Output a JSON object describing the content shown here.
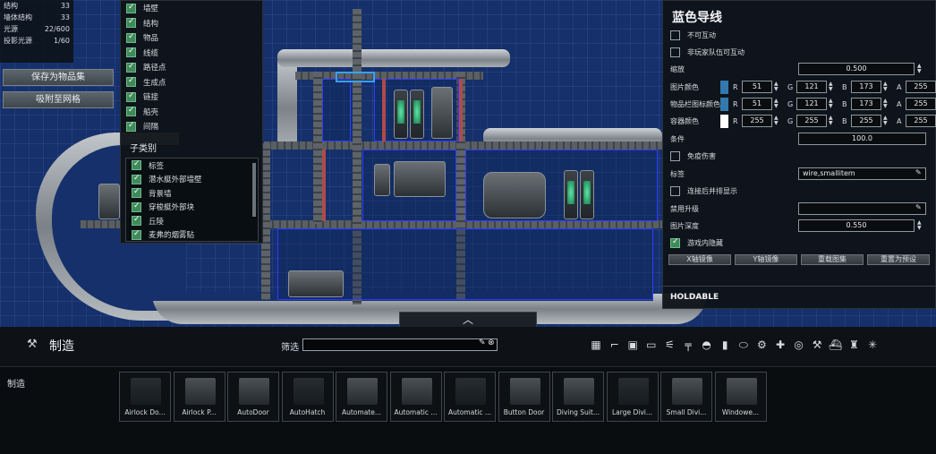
{
  "stats": [
    {
      "label": "结构",
      "value": "33"
    },
    {
      "label": "墙体结构",
      "value": "33"
    },
    {
      "label": "光源",
      "value": "22/600"
    },
    {
      "label": "投影光源",
      "value": "1/60"
    }
  ],
  "left_buttons": {
    "save": "保存为物品集",
    "snap": "吸附至网格"
  },
  "layers": {
    "items": [
      "墙壁",
      "结构",
      "物品",
      "线缆",
      "路径点",
      "生成点",
      "链接",
      "船壳",
      "间隔"
    ],
    "subcategory_title": "子类别",
    "subcategories": [
      "标签",
      "潜水艇外部墙壁",
      "背景墙",
      "穿梭艇外部块",
      "丘陵",
      "麦弗的烟雾贴"
    ]
  },
  "properties": {
    "title": "蓝色导线",
    "non_interactable_label": "不可互动",
    "player_team_interactable_label": "非玩家队伍可互动",
    "scale_label": "缩放",
    "scale_value": "0.500",
    "sprite_color_label": "图片颜色",
    "inventory_color_label": "物品栏图标颜色",
    "container_color_label": "容器颜色",
    "sprite_color": {
      "r": "51",
      "g": "121",
      "b": "173",
      "a": "255",
      "hex": "#3379ad"
    },
    "inventory_color": {
      "r": "51",
      "g": "121",
      "b": "173",
      "a": "255",
      "hex": "#3379ad"
    },
    "container_color": {
      "r": "255",
      "g": "255",
      "b": "255",
      "a": "255",
      "hex": "#ffffff"
    },
    "condition_label": "条件",
    "condition_value": "100.0",
    "invulnerable_label": "免疫伤害",
    "tags_label": "标签",
    "tags_value": "wire,smallitem",
    "hidden_after_connect_label": "连接后并排显示",
    "disallowed_upgrades_label": "禁用升级",
    "disallowed_upgrades_value": "",
    "sprite_depth_label": "图片深度",
    "sprite_depth_value": "0.550",
    "hidden_in_game_label": "游戏内隐藏",
    "buttons": [
      "X轴镜像",
      "Y轴镜像",
      "重载图集",
      "重置为预设"
    ],
    "section_holdable": "HOLDABLE",
    "channel_letters": [
      "R",
      "G",
      "B",
      "A"
    ]
  },
  "bottom": {
    "craft_title": "制造",
    "filter_label": "筛选",
    "filter_value": "",
    "items_label": "制造",
    "items": [
      "Airlock Do...",
      "Airlock P...",
      "AutoDoor",
      "AutoHatch",
      "Automate...",
      "Automatic ...",
      "Automatic ...",
      "Button Door",
      "Diving Suit...",
      "Large Divi...",
      "Small Divi...",
      "Windowe..."
    ],
    "category_icons": [
      "grid-icon",
      "hook-icon",
      "radio-icon",
      "computer-icon",
      "tool-icon",
      "gun-icon",
      "helmet-icon",
      "bottles-icon",
      "pill-icon",
      "gear-icon",
      "medical-icon",
      "target-icon",
      "wrench-icon",
      "submarine-icon",
      "lamp-icon",
      "star-icon"
    ]
  },
  "colors": {
    "accent_green": "#3f8a5a",
    "room_border": "#2e3cff",
    "panel_bg": "#0e1216"
  }
}
